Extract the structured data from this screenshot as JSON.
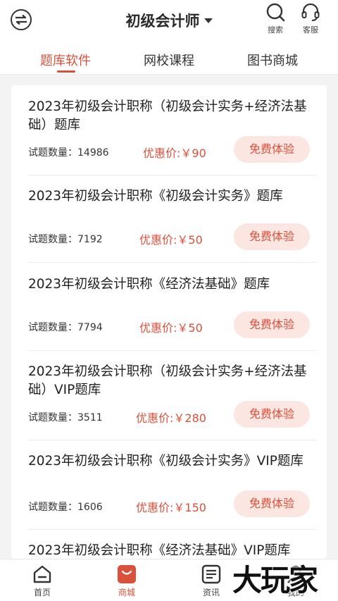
{
  "header": {
    "title": "初级会计师",
    "search_label": "搜索",
    "service_label": "客服"
  },
  "tabs": [
    {
      "label": "题库软件",
      "active": true
    },
    {
      "label": "网校课程",
      "active": false
    },
    {
      "label": "图书商城",
      "active": false
    }
  ],
  "items": [
    {
      "title": "2023年初级会计职称（初级会计实务+经济法基础）题库",
      "count": "试题数量：14986",
      "price": "优惠价:￥90",
      "button": "免费体验"
    },
    {
      "title": "2023年初级会计职称《初级会计实务》题库",
      "count": "试题数量：7192",
      "price": "优惠价:￥50",
      "button": "免费体验"
    },
    {
      "title": "2023年初级会计职称《经济法基础》题库",
      "count": "试题数量：7794",
      "price": "优惠价:￥50",
      "button": "免费体验"
    },
    {
      "title": "2023年初级会计职称（初级会计实务+经济法基础）VIP题库",
      "count": "试题数量：3511",
      "price": "优惠价:￥280",
      "button": "免费体验"
    },
    {
      "title": "2023年初级会计职称《初级会计实务》VIP题库",
      "count": "试题数量：1606",
      "price": "优惠价:￥150",
      "button": "免费体验"
    },
    {
      "title": "2023年初级会计职称《经济法基础》VIP题库"
    }
  ],
  "bottom_nav": [
    {
      "label": "首页",
      "icon": "home-icon",
      "active": false
    },
    {
      "label": "商城",
      "icon": "shopping-bag-icon",
      "active": true
    },
    {
      "label": "资讯",
      "icon": "news-icon",
      "active": false
    },
    {
      "label": "我的",
      "icon": "user-icon",
      "active": false
    }
  ],
  "watermark": "大玩家",
  "colors": {
    "accent": "#d9503b",
    "button_bg": "#fbe6e2",
    "page_bg": "#f3f3f3"
  }
}
